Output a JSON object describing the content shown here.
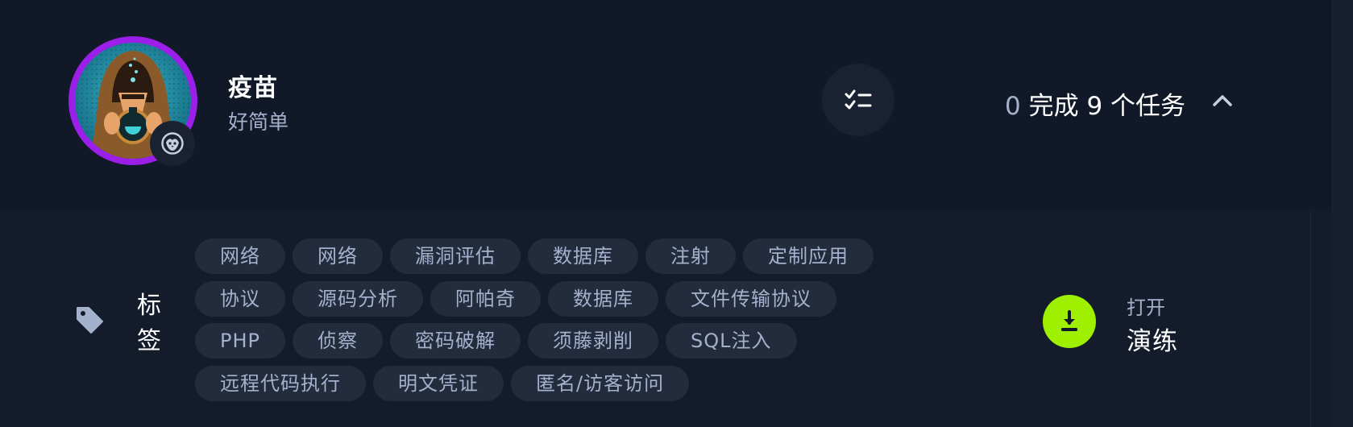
{
  "header": {
    "title": "疫苗",
    "subtitle": "好简单",
    "progress_count": "0",
    "progress_text": "完成 9 个任务"
  },
  "icons": {
    "avatar": "hooded-figure-avatar",
    "badge": "penguin-icon",
    "tasks": "checklist-icon",
    "collapse": "chevron-up-icon",
    "tag": "tag-icon",
    "download": "download-icon"
  },
  "tags_section": {
    "label": "标签",
    "rows": [
      [
        "网络",
        "网络",
        "漏洞评估",
        "数据库",
        "注射",
        "定制应用"
      ],
      [
        "协议",
        "源码分析",
        "阿帕奇",
        "数据库",
        "文件传输协议"
      ],
      [
        "PHP",
        "侦察",
        "密码破解",
        "须藤剥削",
        "SQL注入"
      ],
      [
        "远程代码执行",
        "明文凭证",
        "匿名/访客访问"
      ]
    ]
  },
  "action": {
    "open_label": "打开",
    "drill_label": "演练"
  },
  "colors": {
    "background": "#111827",
    "panel": "#141c2b",
    "tag_bg": "#222c3d",
    "muted_text": "#a4b1cd",
    "accent_green": "#9fef00",
    "avatar_ring": "#9b1fe8"
  }
}
